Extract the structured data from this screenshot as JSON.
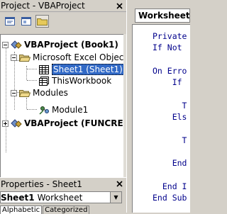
{
  "project": {
    "title": "Project - VBAProject",
    "tree": {
      "book1": "VBAProject (Book1)",
      "excel_objects": "Microsoft Excel Objects",
      "sheet1": "Sheet1 (Sheet1)",
      "thisworkbook": "ThisWorkbook",
      "modules": "Modules",
      "module1": "Module1",
      "funcres": "VBAProject (FUNCRES.XL"
    }
  },
  "properties": {
    "title": "Properties - Sheet1",
    "object_name": "Sheet1",
    "object_type": "Worksheet",
    "tabs": [
      "Alphabetic",
      "Categorized"
    ]
  },
  "code": {
    "object_combo": "Worksheet",
    "lines": [
      "Private",
      "If Not ",
      "",
      "On Erro",
      "    If ",
      "",
      "      T",
      "    Els",
      "",
      "      T",
      "",
      "    End",
      "",
      "  End I",
      "End Sub"
    ]
  },
  "colors": {
    "selection": "#3169c6",
    "keyword": "#00008b",
    "folder": "#e6c95a"
  }
}
